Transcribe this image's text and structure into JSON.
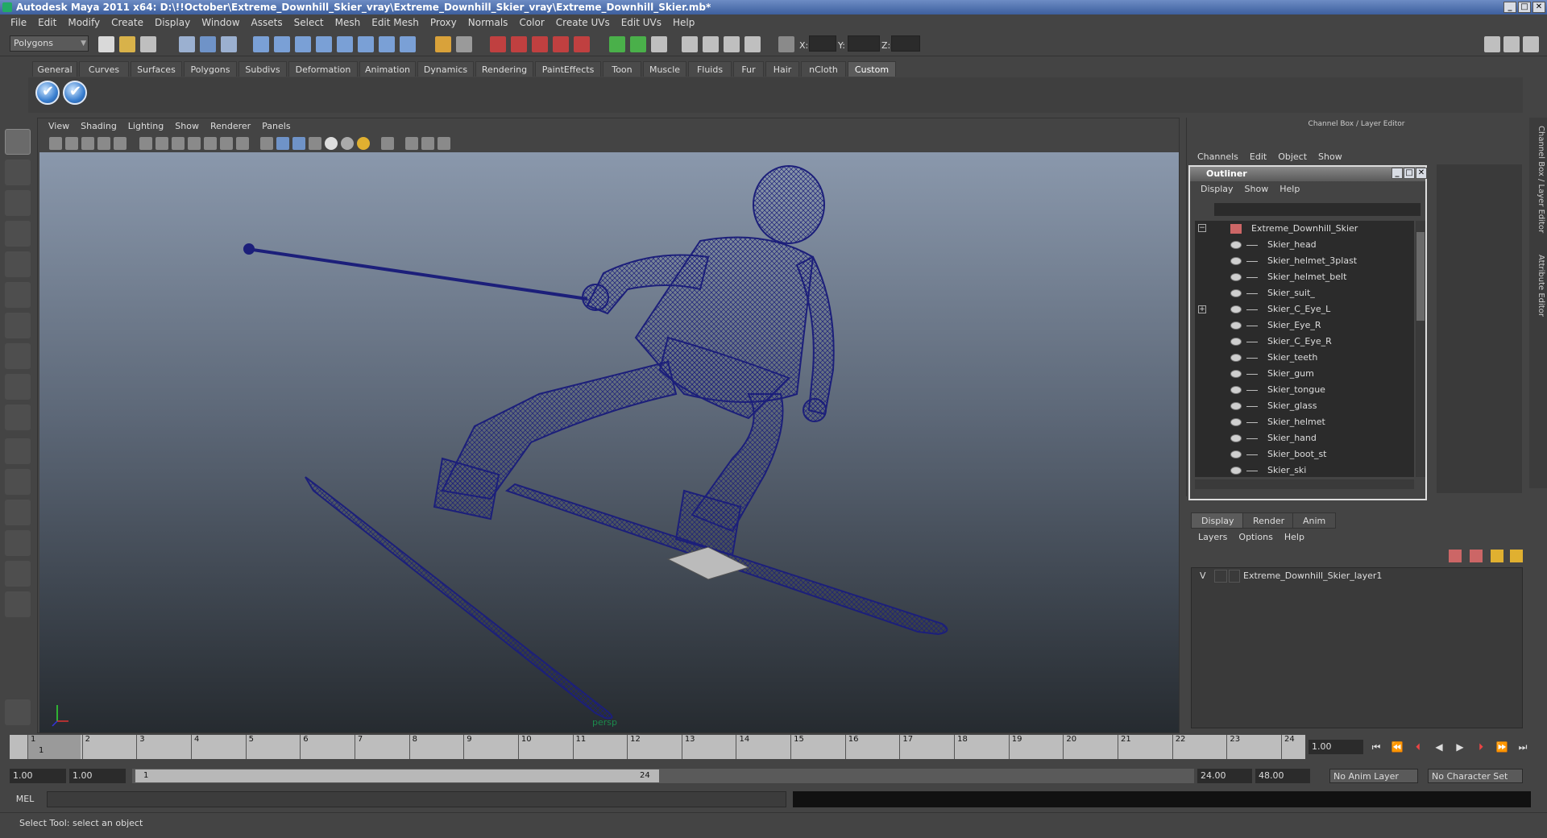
{
  "window": {
    "title": "Autodesk Maya 2011 x64: D:\\!!October\\Extreme_Downhill_Skier_vray\\Extreme_Downhill_Skier_vray\\Extreme_Downhill_Skier.mb*"
  },
  "menubar": [
    "File",
    "Edit",
    "Modify",
    "Create",
    "Display",
    "Window",
    "Assets",
    "Select",
    "Mesh",
    "Edit Mesh",
    "Proxy",
    "Normals",
    "Color",
    "Create UVs",
    "Edit UVs",
    "Help"
  ],
  "statusline": {
    "mode": "Polygons",
    "x_label": "X:",
    "y_label": "Y:",
    "z_label": "Z:"
  },
  "shelf_tabs": [
    "General",
    "Curves",
    "Surfaces",
    "Polygons",
    "Subdivs",
    "Deformation",
    "Animation",
    "Dynamics",
    "Rendering",
    "PaintEffects",
    "Toon",
    "Muscle",
    "Fluids",
    "Fur",
    "Hair",
    "nCloth",
    "Custom"
  ],
  "active_shelf": "Custom",
  "viewport": {
    "menu": [
      "View",
      "Shading",
      "Lighting",
      "Show",
      "Renderer",
      "Panels"
    ],
    "camera": "persp"
  },
  "channel_box": {
    "title": "Channel Box / Layer Editor",
    "menu": [
      "Channels",
      "Edit",
      "Object",
      "Show"
    ]
  },
  "outliner": {
    "title": "Outliner",
    "menu": [
      "Display",
      "Show",
      "Help"
    ],
    "root": "Extreme_Downhill_Skier",
    "items": [
      "Skier_head",
      "Skier_helmet_3plast",
      "Skier_helmet_belt",
      "Skier_suit_",
      "Skier_C_Eye_L",
      "Skier_Eye_R",
      "Skier_C_Eye_R",
      "Skier_teeth",
      "Skier_gum",
      "Skier_tongue",
      "Skier_glass",
      "Skier_helmet",
      "Skier_hand",
      "Skier_boot_st",
      "Skier_ski"
    ]
  },
  "layer_editor": {
    "tabs": [
      "Display",
      "Render",
      "Anim"
    ],
    "active_tab": "Display",
    "menu": [
      "Layers",
      "Options",
      "Help"
    ],
    "layer": {
      "visible": "V",
      "name": "Extreme_Downhill_Skier_layer1"
    }
  },
  "side_tabs": [
    "Channel Box / Layer Editor",
    "Attribute Editor"
  ],
  "timeline": {
    "ticks": [
      "1",
      "2",
      "3",
      "4",
      "5",
      "6",
      "7",
      "8",
      "9",
      "10",
      "11",
      "12",
      "13",
      "14",
      "15",
      "16",
      "17",
      "18",
      "19",
      "20",
      "21",
      "22",
      "23",
      "24"
    ],
    "current_frame_label": "1",
    "current_frame": "1.00"
  },
  "range": {
    "start": "1.00",
    "playback_start": "1.00",
    "thumb_start": "1",
    "thumb_end": "24",
    "playback_end": "24.00",
    "end": "48.00",
    "anim_layer": "No Anim Layer",
    "character_set": "No Character Set"
  },
  "command": {
    "label": "MEL"
  },
  "help_line": "Select Tool: select an object",
  "colors": {
    "wire": "#1c1f7a",
    "viewport_top": "#8a98ac",
    "viewport_bottom": "#262b30"
  }
}
